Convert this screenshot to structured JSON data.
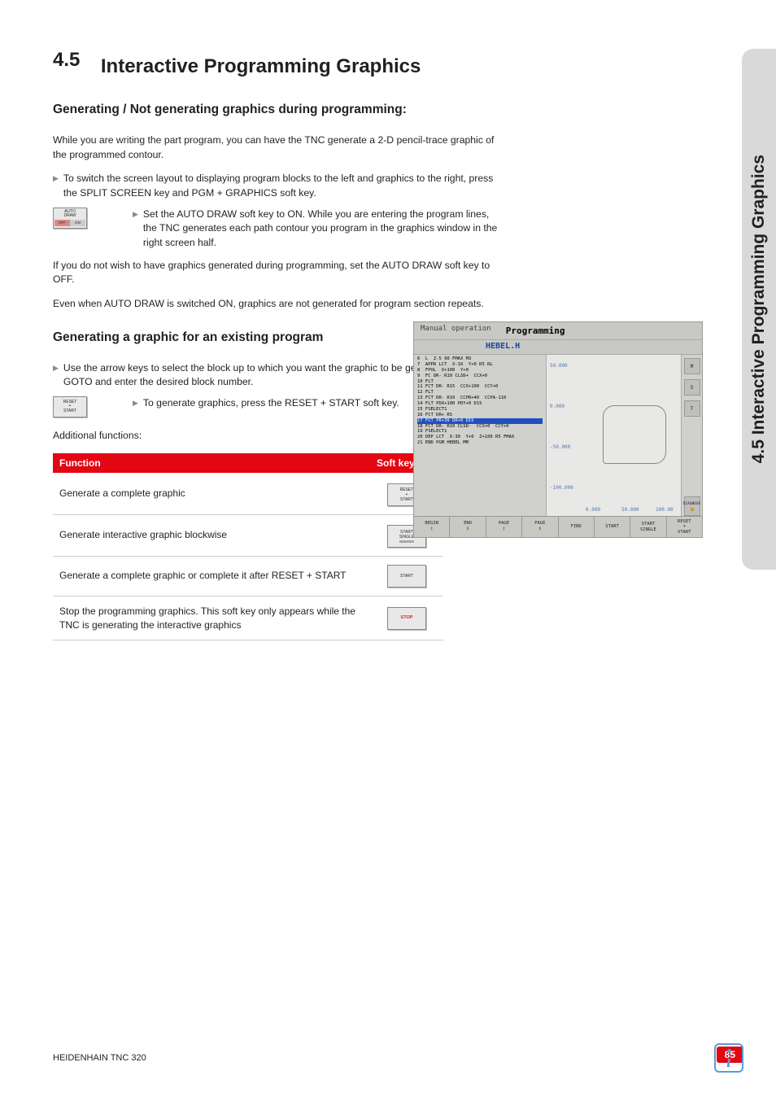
{
  "side_tab": "4.5 Interactive Programming Graphics",
  "section": {
    "num": "4.5",
    "title": "Interactive Programming Graphics"
  },
  "h2a": "Generating / Not generating graphics during programming:",
  "p1": "While you are writing the part program, you can have the TNC generate a 2-D pencil-trace graphic of the programmed contour.",
  "li1": "To switch the screen layout to displaying program blocks to the left and graphics to the right, press the SPLIT SCREEN key and PGM + GRAPHICS soft key.",
  "sk_auto": {
    "l1": "AUTO",
    "l2": "DRAW",
    "off": "OFF",
    "on": "ON"
  },
  "li2": "Set the AUTO DRAW soft key to ON. While you are entering the program lines, the TNC generates each path contour you program in the graphics window in the right screen half.",
  "p2": "If you do not wish to have graphics generated during programming, set the AUTO DRAW soft key to OFF.",
  "p3": "Even when AUTO DRAW is switched ON, graphics are not generated for program section repeats.",
  "h2b": "Generating a graphic for an existing program",
  "li3": "Use the arrow keys to select the block up to which you want the graphic to be generated, or press GOTO and enter the desired block number.",
  "sk_reset": {
    "l1": "RESET",
    "l2": "+",
    "l3": "START"
  },
  "li4": "To generate graphics, press the RESET + START soft key.",
  "p4": "Additional functions:",
  "table": {
    "h1": "Function",
    "h2": "Soft key",
    "rows": [
      {
        "fn": "Generate a complete graphic",
        "sk": [
          "RESET",
          "+",
          "START"
        ]
      },
      {
        "fn": "Generate interactive graphic blockwise",
        "sk": [
          "START",
          "SINGLE",
          "_bar"
        ]
      },
      {
        "fn": "Generate a complete graphic or complete it after RESET + START",
        "sk": [
          "START"
        ]
      },
      {
        "fn": "Stop the programming graphics. This soft key only appears while the TNC is generating the interactive graphics",
        "sk": [
          "_STOP"
        ]
      }
    ]
  },
  "screenshot": {
    "tab_small": "Manual operation",
    "tab_main": "Programming",
    "file": "HEBEL.H",
    "code": "6  L  Z-5 90 FMAX M3\n7  APPR LCT  X-10  Y+0 R5 RL\n8  FPOL  X+100  Y+0\n9  FC DR- R10 CLSD+  CCX+0\n10 FLT\n11 FCT DR- R15  CCX+100  CCY+0\n12 FLT\n13 FCT DR- R10  CCPR+40  CCPA-110\n14 FLT PDX+100 PDY+0 D15\n15 FSELECT1\n16 FCT DR+ R5",
    "code_hl": "17 FCT PR+30 DR+0 D15",
    "code2": "18 FCT DR- R10 CLSD-  CCX+0  CCY+0\n19 FSELECT1\n20 DEP LCT  X-30  Y+0  Z+100 R5 FMAX\n21 END PGM HEBEL MM",
    "y_ticks": [
      "50.000",
      "0.000",
      "-50.000",
      "-100.000"
    ],
    "x_ticks": [
      "0.000",
      "50.000",
      "100.00"
    ],
    "right_icons": [
      "M",
      "S",
      "T",
      "",
      "DIAGNOSE"
    ],
    "softkeys": [
      "BEGIN",
      "END",
      "PAGE",
      "PAGE",
      "FIND",
      "START",
      "START\nSINGLE",
      "RESET\n+\nSTART"
    ]
  },
  "footer": {
    "left": "HEIDENHAIN TNC 320",
    "page": "85"
  }
}
